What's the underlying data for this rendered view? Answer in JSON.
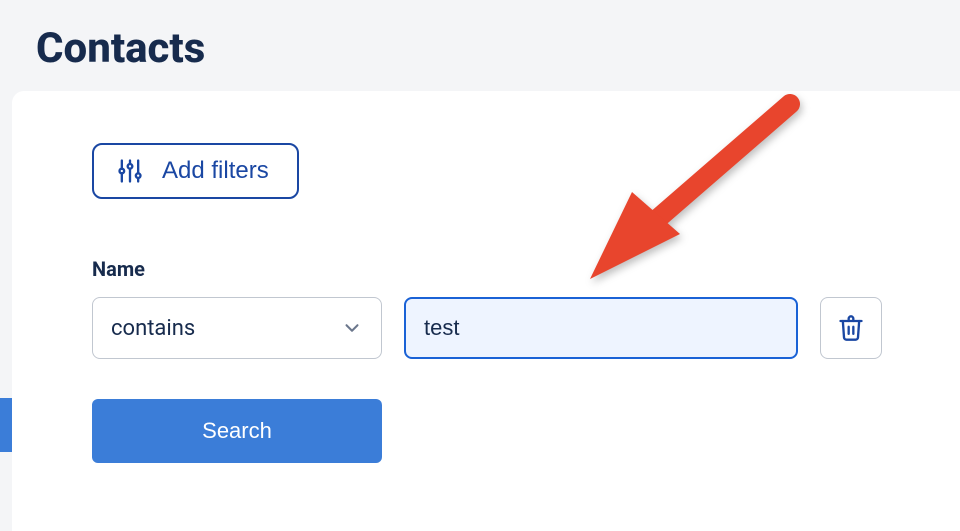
{
  "page": {
    "title": "Contacts"
  },
  "filters": {
    "add_button_label": "Add filters",
    "field_label": "Name",
    "operator_selected": "contains",
    "value": "test",
    "search_button_label": "Search"
  },
  "colors": {
    "primary": "#3b7dd8",
    "outline": "#1a47a3",
    "focus_border": "#1a62d6",
    "focus_bg": "#eef4ff",
    "text": "#172b4d",
    "border": "#c1c7d0",
    "annotation": "#e8452d"
  }
}
